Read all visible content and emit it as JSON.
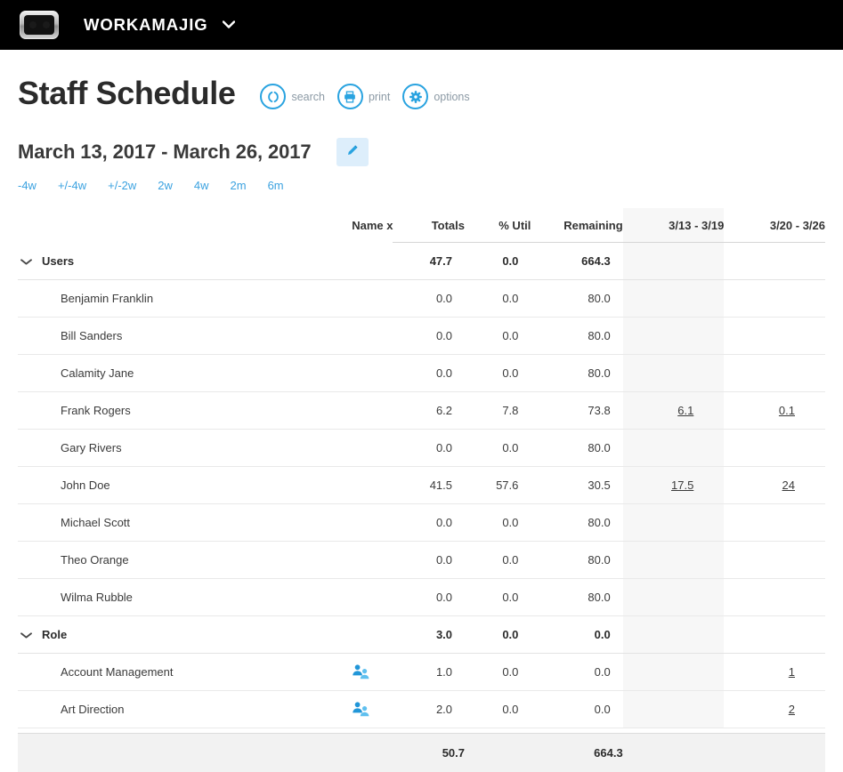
{
  "topbar": {
    "brand": "WORKAMAJIG",
    "caret": "⌄",
    "logo_icon": "robot-logo-icon",
    "dropdown_icon": "chevron-down-icon"
  },
  "header": {
    "title": "Staff Schedule",
    "actions": [
      {
        "id": "search",
        "label": "search",
        "icon": "search-icon"
      },
      {
        "id": "print",
        "label": "print",
        "icon": "print-icon"
      },
      {
        "id": "options",
        "label": "options",
        "icon": "gear-icon"
      }
    ]
  },
  "daterange": {
    "label": "March 13, 2017 - March 26, 2017",
    "edit_icon": "pencil-icon",
    "quick_links": [
      "-4w",
      "+/-4w",
      "+/-2w",
      "2w",
      "4w",
      "2m",
      "6m"
    ]
  },
  "table": {
    "columns": [
      {
        "key": "name",
        "label": "Name x"
      },
      {
        "key": "icon",
        "label": ""
      },
      {
        "key": "totals",
        "label": "Totals"
      },
      {
        "key": "util",
        "label": "% Util"
      },
      {
        "key": "remaining",
        "label": "Remaining"
      },
      {
        "key": "week1",
        "label": "3/13 - 3/19",
        "shaded": true
      },
      {
        "key": "week2",
        "label": "3/20 - 3/26"
      }
    ],
    "rows": [
      {
        "type": "group",
        "name": "Users",
        "icon": "",
        "totals": "47.7",
        "util": "0.0",
        "remaining": "664.3",
        "week1": "",
        "week2": ""
      },
      {
        "type": "child",
        "name": "Benjamin Franklin",
        "icon": "",
        "totals": "0.0",
        "util": "0.0",
        "remaining": "80.0",
        "week1": "",
        "week2": ""
      },
      {
        "type": "child",
        "name": "Bill Sanders",
        "icon": "",
        "totals": "0.0",
        "util": "0.0",
        "remaining": "80.0",
        "week1": "",
        "week2": ""
      },
      {
        "type": "child",
        "name": "Calamity Jane",
        "icon": "",
        "totals": "0.0",
        "util": "0.0",
        "remaining": "80.0",
        "week1": "",
        "week2": ""
      },
      {
        "type": "child",
        "name": "Frank Rogers",
        "icon": "",
        "totals": "6.2",
        "util": "7.8",
        "remaining": "73.8",
        "week1": "6.1",
        "week2": "0.1",
        "week1_link": true,
        "week2_link": true
      },
      {
        "type": "child",
        "name": "Gary Rivers",
        "icon": "",
        "totals": "0.0",
        "util": "0.0",
        "remaining": "80.0",
        "week1": "",
        "week2": ""
      },
      {
        "type": "child",
        "name": "John Doe",
        "icon": "",
        "totals": "41.5",
        "util": "57.6",
        "remaining": "30.5",
        "week1": "17.5",
        "week2": "24",
        "week1_link": true,
        "week2_link": true
      },
      {
        "type": "child",
        "name": "Michael Scott",
        "icon": "",
        "totals": "0.0",
        "util": "0.0",
        "remaining": "80.0",
        "week1": "",
        "week2": ""
      },
      {
        "type": "child",
        "name": "Theo Orange",
        "icon": "",
        "totals": "0.0",
        "util": "0.0",
        "remaining": "80.0",
        "week1": "",
        "week2": ""
      },
      {
        "type": "child",
        "name": "Wilma Rubble",
        "icon": "",
        "totals": "0.0",
        "util": "0.0",
        "remaining": "80.0",
        "week1": "",
        "week2": ""
      },
      {
        "type": "group",
        "name": "Role",
        "icon": "",
        "totals": "3.0",
        "util": "0.0",
        "remaining": "0.0",
        "week1": "",
        "week2": ""
      },
      {
        "type": "child",
        "name": "Account Management",
        "icon": "people-group-icon",
        "totals": "1.0",
        "util": "0.0",
        "remaining": "0.0",
        "week1": "",
        "week2": "1",
        "week2_link": true
      },
      {
        "type": "child",
        "name": "Art Direction",
        "icon": "people-group-icon",
        "totals": "2.0",
        "util": "0.0",
        "remaining": "0.0",
        "week1": "",
        "week2": "2",
        "week2_link": true
      }
    ],
    "footer": {
      "name": "",
      "icon": "",
      "totals": "50.7",
      "util": "",
      "remaining": "664.3",
      "week1": "",
      "week2": ""
    },
    "collapse_icon": "chevron-down-icon"
  },
  "colors": {
    "accent": "#29a3e0",
    "link": "#3ba2e0",
    "topbar_bg": "#000000",
    "shaded_col": "#f7f7f7",
    "footer_bg": "#f2f2f2",
    "title_text": "#2b2b2b"
  }
}
